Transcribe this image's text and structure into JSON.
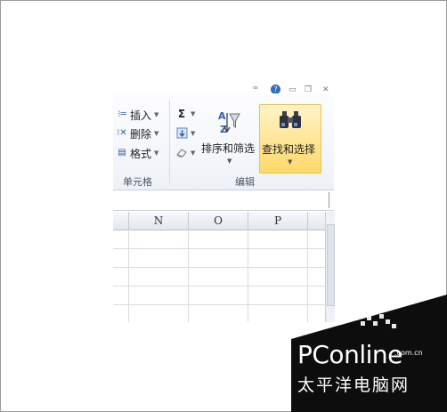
{
  "ribbon": {
    "cells_group": {
      "insert": "插入",
      "delete": "删除",
      "format": "格式",
      "label": "单元格"
    },
    "editing_group": {
      "sum_symbol": "Σ",
      "sort_filter": "排序和筛选",
      "find_select": "查找和选择",
      "label": "编辑"
    }
  },
  "columns": [
    "N",
    "O",
    "P"
  ],
  "watermark": {
    "brand": "PConline",
    "domain": ".com.cn",
    "chinese": "太平洋电脑网"
  },
  "colors": {
    "highlight": "#ffd969",
    "ribbon_bg": "#eef2f8"
  }
}
